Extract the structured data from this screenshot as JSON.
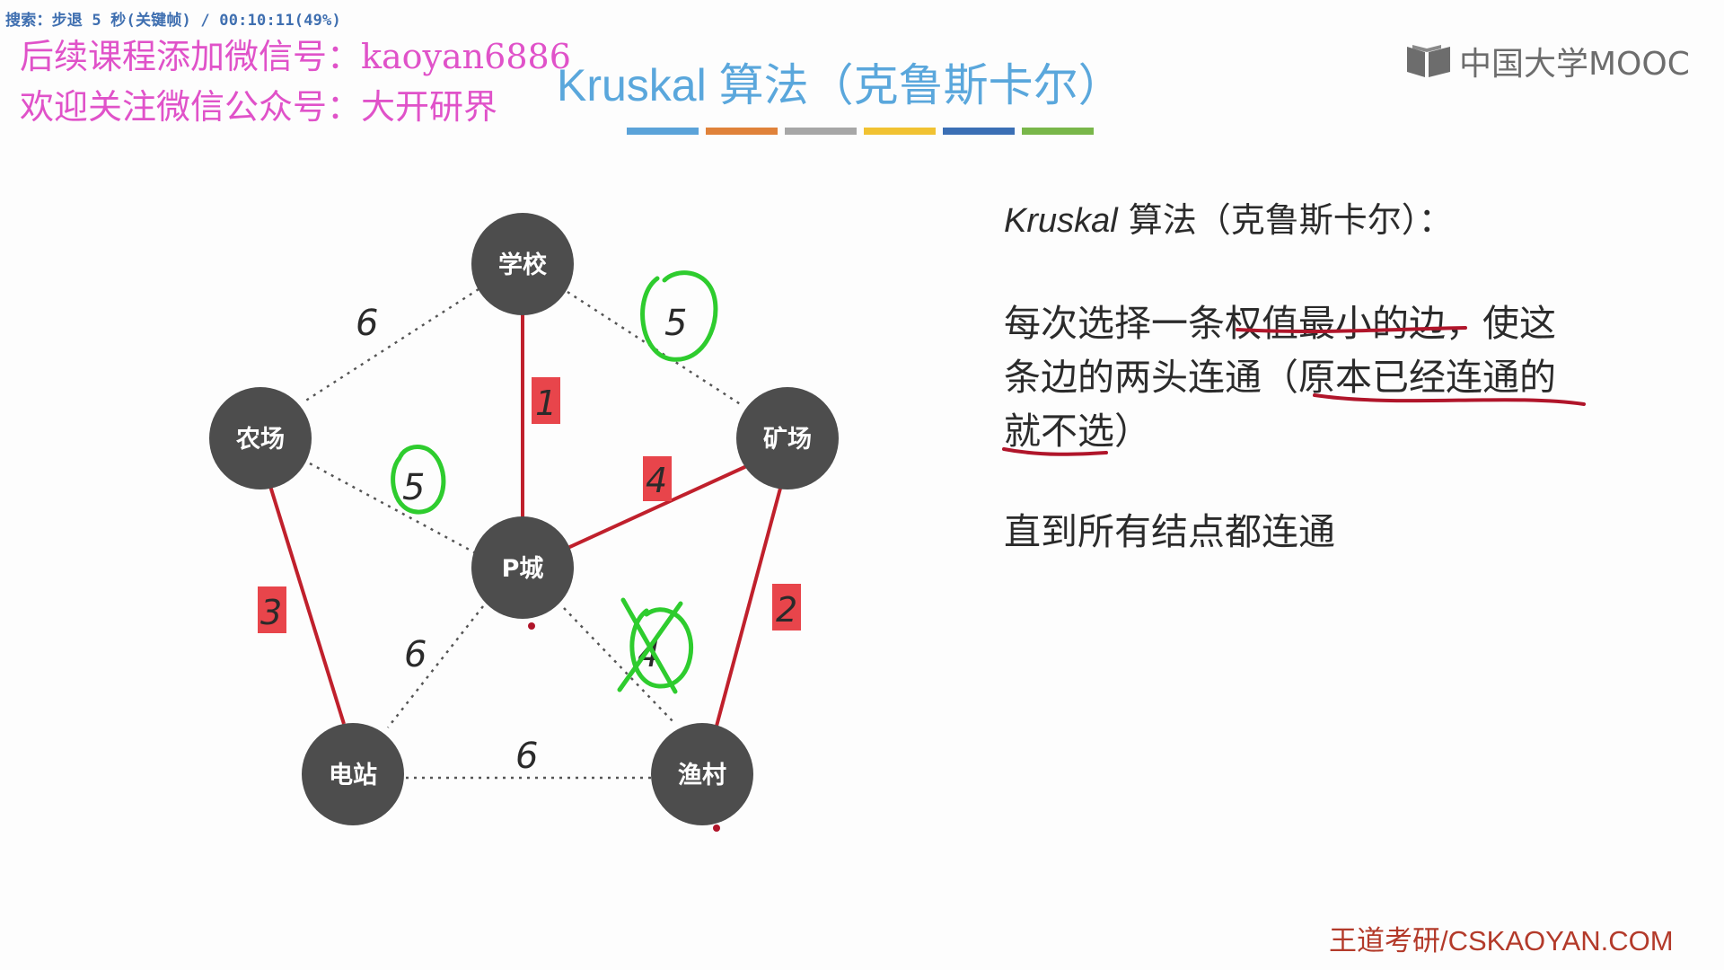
{
  "overlay": {
    "status_text": "搜索：步退 5 秒(关键帧) / 00:10:11(49%)",
    "promo_line1": "后续课程添加微信号：kaoyan6886",
    "promo_line2": "欢迎关注微信公众号：大开研界"
  },
  "slide": {
    "title": "Kruskal 算法（克鲁斯卡尔）",
    "title_bar_colors": [
      "#5ba3d9",
      "#e0823a",
      "#a7a7a7",
      "#f1c232",
      "#3b6fb5",
      "#79b74a"
    ],
    "brand": "中国大学MOOC",
    "footer": "王道考研/CSKAOYAN.COM"
  },
  "explanation": {
    "heading_italic": "Kruskal",
    "heading_rest": " 算法（克鲁斯卡尔）：",
    "line1": "每次选择一条权值最小的边，使这",
    "line2": "条边的两头连通（原本已经连通的",
    "line3": "就不选）",
    "line4": "直到所有结点都连通"
  },
  "graph": {
    "nodes": {
      "school": "学校",
      "farm": "农场",
      "mine": "矿场",
      "pcity": "P城",
      "station": "电站",
      "village": "渔村"
    },
    "edge_weights": {
      "school_farm": "6",
      "school_mine": "5",
      "school_pcity": "1",
      "farm_pcity": "5",
      "mine_pcity": "4",
      "farm_station": "3",
      "mine_village": "2",
      "pcity_station": "6",
      "pcity_village": "4",
      "station_village": "6"
    }
  },
  "colors": {
    "node_fill": "#4d4d4d",
    "selected_edge": "#c0202c",
    "label_box": "#e8454b",
    "annotation_green": "#2ecc2e",
    "annotation_red": "#b0152a"
  }
}
